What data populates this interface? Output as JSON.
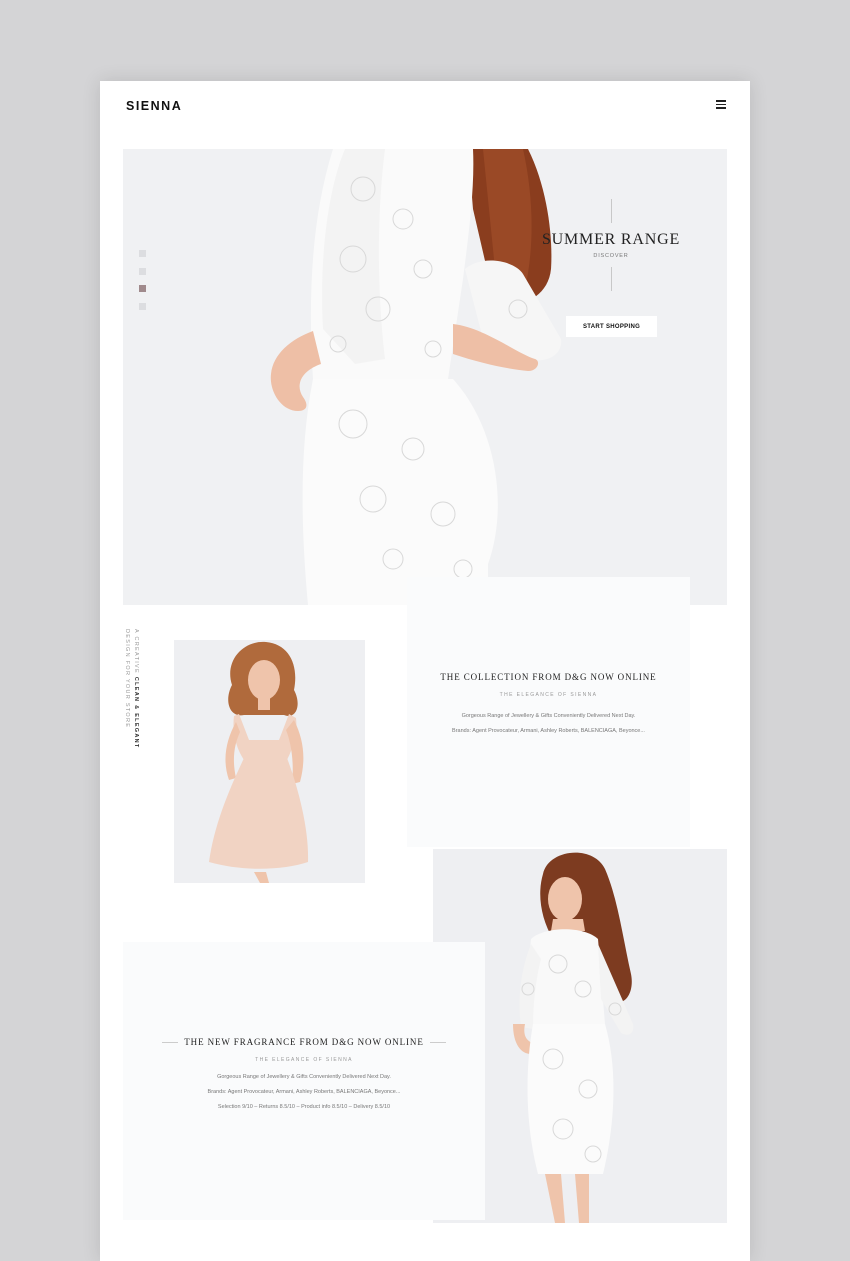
{
  "brand": {
    "logo": "SIENNA"
  },
  "hero": {
    "title": "SUMMER RANGE",
    "subtitle": "DISCOVER",
    "button": "START SHOPPING",
    "slide_count": 4,
    "active_slide": 3
  },
  "side_text": {
    "line1_prefix": "A CREATIVE ",
    "line1_bold": "CLEAN & ELEGANT",
    "line2": "DESIGN FOR YOUR STORE"
  },
  "collection": {
    "title": "THE COLLECTION FROM D&G NOW ONLINE",
    "subtitle": "THE ELEGANCE OF SIENNA",
    "lines": [
      "Gorgeous Range of Jewellery & Gifts Conveniently Delivered Next Day.",
      "Brands: Agent Provocateur, Armani, Ashley Roberts, BALENCIAGA, Beyonce..."
    ]
  },
  "fragrance": {
    "title": "THE NEW FRAGRANCE FROM D&G NOW ONLINE",
    "subtitle": "THE ELEGANCE OF SIENNA",
    "lines": [
      "Gorgeous Range of Jewellery & Gifts Conveniently Delivered Next Day.",
      "Brands: Agent Provocateur, Armani, Ashley Roberts, BALENCIAGA, Beyonce...",
      "Selection 9/10 – Returns 8.5/10 – Product info 8.5/10 – Delivery 8.5/10"
    ]
  },
  "icons": {
    "menu": "hamburger-menu-icon"
  },
  "colors": {
    "accent_dot": "#a08a8c",
    "hair": "#8a3d1e",
    "skin": "#eebfa6",
    "peach_dress": "#f1d3c3",
    "lace_dress": "#fbfbfb"
  }
}
